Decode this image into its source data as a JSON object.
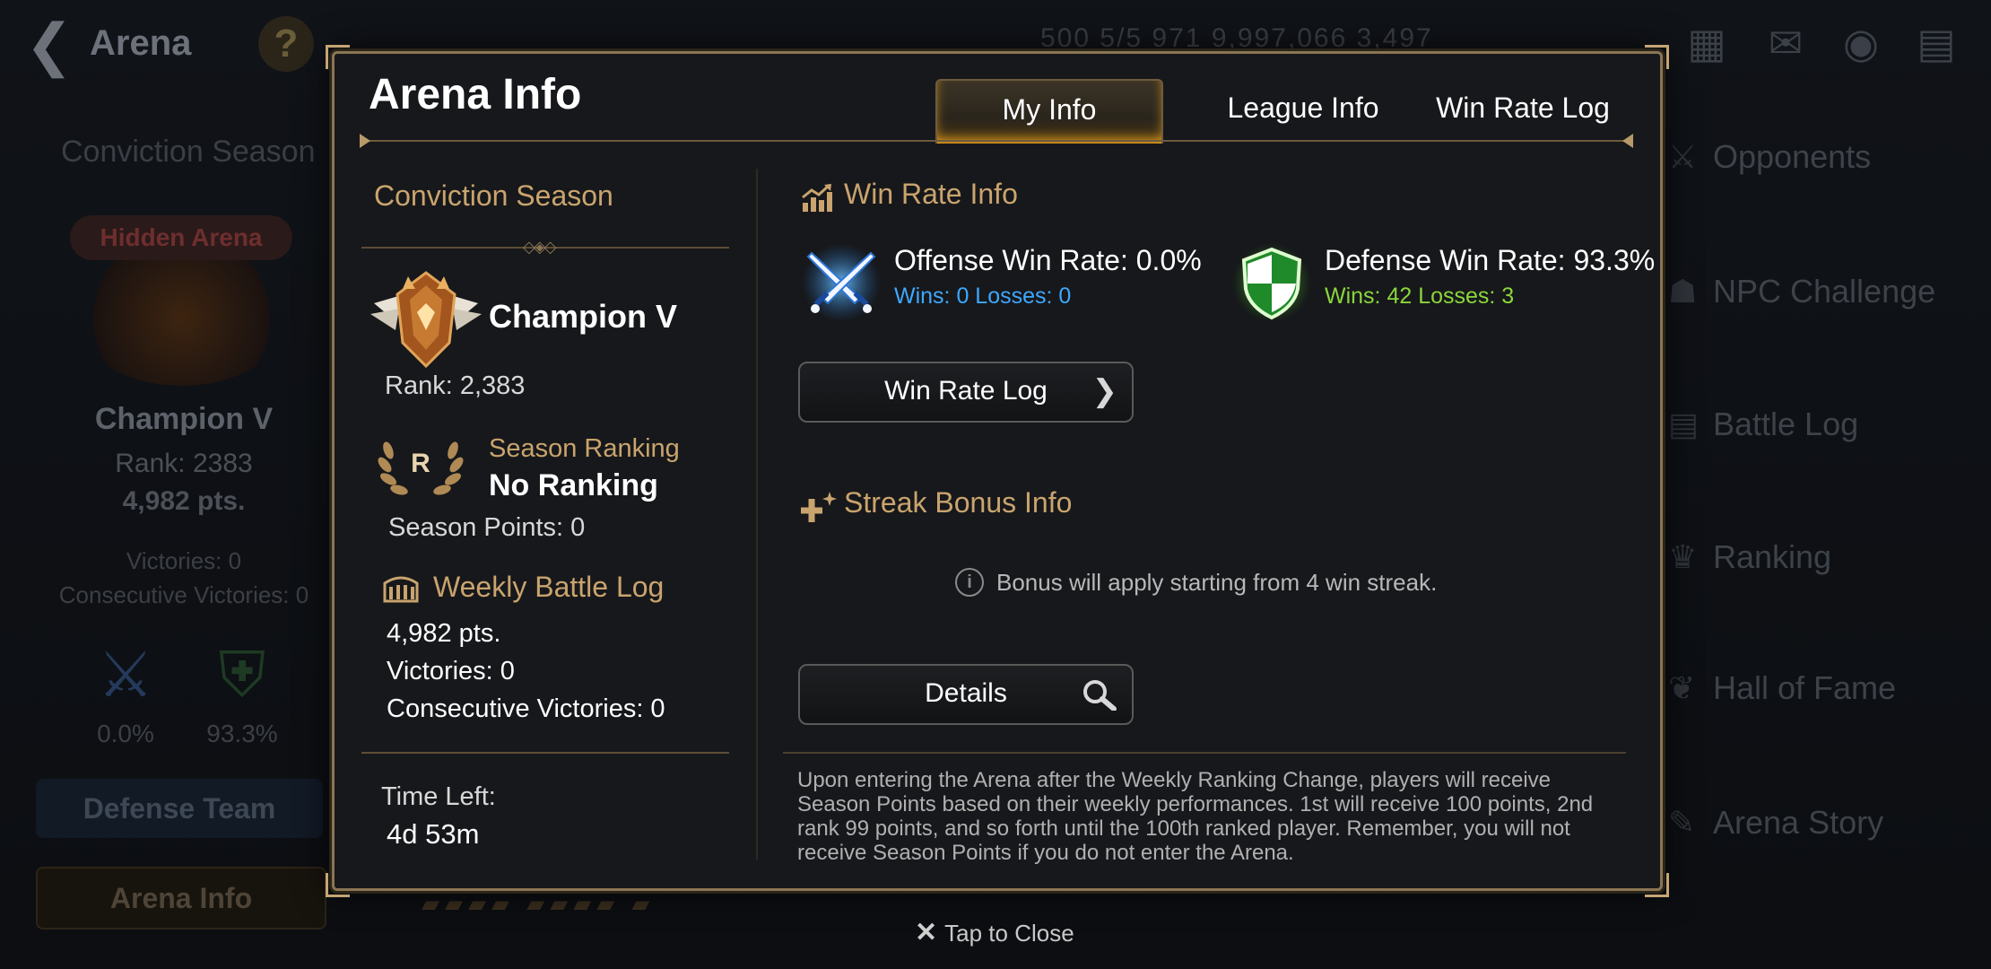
{
  "background": {
    "title": "Arena",
    "resources": "500   5/5   971   9,997,066   3,497",
    "left": {
      "season": "Conviction Season",
      "hidden_tag": "Hidden Arena",
      "champ": "Champion V",
      "rank": "Rank: 2383",
      "pts": "4,982 pts.",
      "victories": "Victories: 0",
      "consecutive": "Consecutive Victories: 0",
      "offense_rate": "0.0%",
      "defense_rate": "93.3%",
      "defense_team": "Defense Team",
      "arena_info": "Arena Info"
    },
    "right_menu": [
      "Opponents",
      "NPC Challenge",
      "Battle Log",
      "Ranking",
      "Hall of Fame",
      "Arena Story"
    ]
  },
  "modal": {
    "title": "Arena Info",
    "tabs": [
      "My Info",
      "League Info",
      "Win Rate Log"
    ],
    "left": {
      "season_title": "Conviction Season",
      "champ_name": "Champion V",
      "rank": "Rank: 2,383",
      "season_ranking_label": "Season Ranking",
      "season_ranking_value": "No Ranking",
      "laurel_letter": "R",
      "season_points": "Season Points: 0",
      "weekly_title": "Weekly Battle Log",
      "weekly_pts": "4,982 pts.",
      "weekly_victories": "Victories: 0",
      "weekly_consecutive": "Consecutive Victories: 0",
      "time_left_label": "Time Left:",
      "time_left_value": "4d 53m"
    },
    "right": {
      "win_rate_title": "Win Rate Info",
      "offense_title": "Offense Win Rate: 0.0%",
      "offense_sub": "Wins: 0 Losses: 0",
      "defense_title": "Defense Win Rate: 93.3%",
      "defense_sub": "Wins: 42 Losses: 3",
      "win_rate_log_button": "Win Rate Log",
      "streak_title": "Streak Bonus Info",
      "streak_info": "Bonus will apply starting from 4 win streak.",
      "details_button": "Details",
      "description": "Upon entering the Arena after the Weekly Ranking Change, players will receive Season Points based on their weekly performances. 1st will receive 100 points, 2nd rank 99 points, and so forth until the 100th ranked player. Remember, you will not receive Season Points if you do not enter the Arena."
    }
  },
  "close_hint": "Tap to Close",
  "colors": {
    "gold": "#c9a46e",
    "offense_blue": "#3ea8ff",
    "defense_green": "#8bd63c",
    "tab_glow": "#ffb020"
  },
  "icons": {
    "offense": "crossed-swords-icon",
    "defense": "shield-icon",
    "win_rate": "chart-up-icon",
    "streak": "sparkle-plus-icon",
    "weekly": "colosseum-icon",
    "search": "magnifier-icon",
    "chevron": "chevron-right-icon",
    "info": "info-icon",
    "close": "close-icon"
  }
}
